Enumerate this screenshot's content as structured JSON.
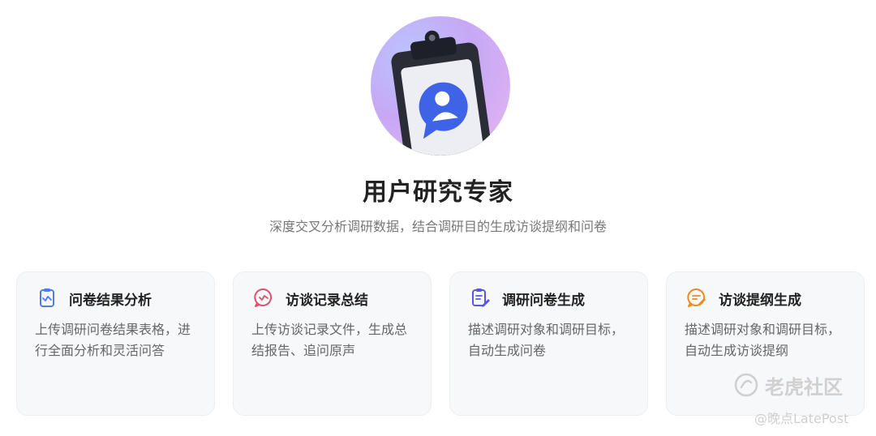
{
  "hero": {
    "icon": "clipboard-user-chat-icon",
    "title": "用户研究专家",
    "subtitle": "深度交叉分析调研数据，结合调研目的生成访谈提纲和问卷"
  },
  "cards": [
    {
      "title": "问卷结果分析",
      "desc": "上传调研问卷结果表格，进行全面分析和灵活问答",
      "icon": "questionnaire-analysis-icon",
      "accent": "#4a7df0"
    },
    {
      "title": "访谈记录总结",
      "desc": "上传访谈记录文件，生成总结报告、追问原声",
      "icon": "interview-chat-icon",
      "accent": "#e0506e"
    },
    {
      "title": "调研问卷生成",
      "desc": "描述调研对象和调研目标，自动生成问卷",
      "icon": "survey-generate-icon",
      "accent": "#5b57d8"
    },
    {
      "title": "访谈提纲生成",
      "desc": "描述调研对象和调研目标，自动生成访谈提纲",
      "icon": "outline-generate-icon",
      "accent": "#ee8a1e"
    }
  ],
  "watermark": {
    "brand": "老虎社区",
    "handle": "@晚点LatePost"
  }
}
